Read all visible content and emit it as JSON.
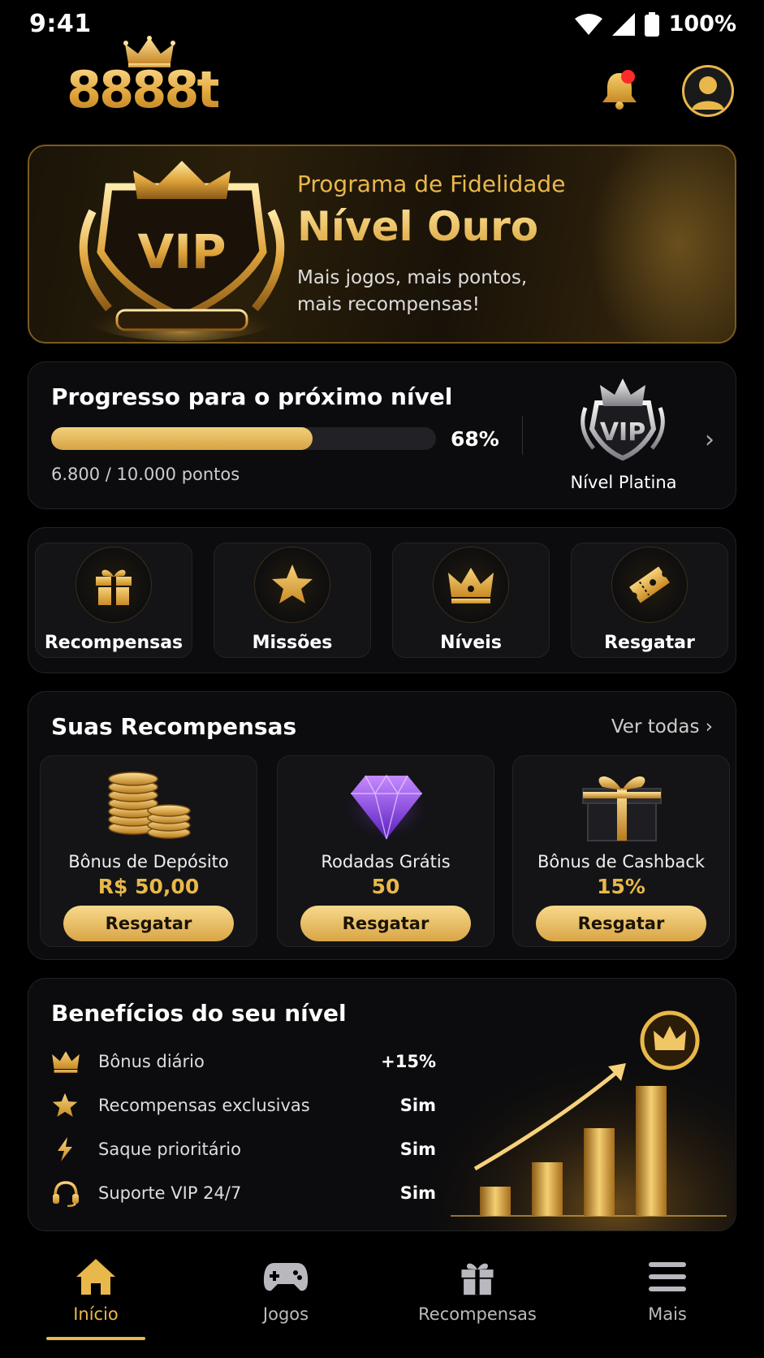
{
  "status_bar": {
    "time": "9:41",
    "battery": "100%"
  },
  "header": {
    "logo_text": "8888t"
  },
  "hero": {
    "badge_text": "VIP",
    "subtitle": "Programa de Fidelidade",
    "title": "Nível Ouro",
    "description": "Mais jogos, mais pontos, mais recompensas!"
  },
  "progress": {
    "title": "Progresso para o próximo nível",
    "percent_label": "68%",
    "percent_value": 0.68,
    "points": "6.800 / 10.000 pontos",
    "next_badge_text": "VIP",
    "next_level": "Nível Platina"
  },
  "quick_actions": [
    {
      "label": "Recompensas",
      "icon": "gift-icon"
    },
    {
      "label": "Missões",
      "icon": "star-icon"
    },
    {
      "label": "Níveis",
      "icon": "crown-icon"
    },
    {
      "label": "Resgatar",
      "icon": "ticket-icon"
    }
  ],
  "rewards": {
    "title": "Suas Recompensas",
    "see_all": "Ver todas",
    "items": [
      {
        "name": "Bônus de Depósito",
        "value": "R$ 50,00",
        "button": "Resgatar",
        "icon": "coins-icon"
      },
      {
        "name": "Rodadas Grátis",
        "value": "50",
        "button": "Resgatar",
        "icon": "diamond-icon"
      },
      {
        "name": "Bônus de Cashback",
        "value": "15%",
        "button": "Resgatar",
        "icon": "gift-box-icon"
      }
    ]
  },
  "benefits": {
    "title": "Benefícios do seu nível",
    "items": [
      {
        "label": "Bônus diário",
        "value": "+15%",
        "icon": "crown-icon"
      },
      {
        "label": "Recompensas exclusivas",
        "value": "Sim",
        "icon": "star-icon"
      },
      {
        "label": "Saque prioritário",
        "value": "Sim",
        "icon": "lightning-icon"
      },
      {
        "label": "Suporte VIP 24/7",
        "value": "Sim",
        "icon": "headset-icon"
      }
    ]
  },
  "nav": {
    "items": [
      {
        "label": "Início",
        "icon": "home-icon",
        "active": true
      },
      {
        "label": "Jogos",
        "icon": "gamepad-icon",
        "active": false
      },
      {
        "label": "Recompensas",
        "icon": "gift-icon",
        "active": false
      },
      {
        "label": "Mais",
        "icon": "menu-icon",
        "active": false
      }
    ]
  },
  "colors": {
    "gold": "#e9b84a",
    "background": "#000000",
    "card": "#0c0c0e",
    "notification": "#ff2a2a"
  }
}
